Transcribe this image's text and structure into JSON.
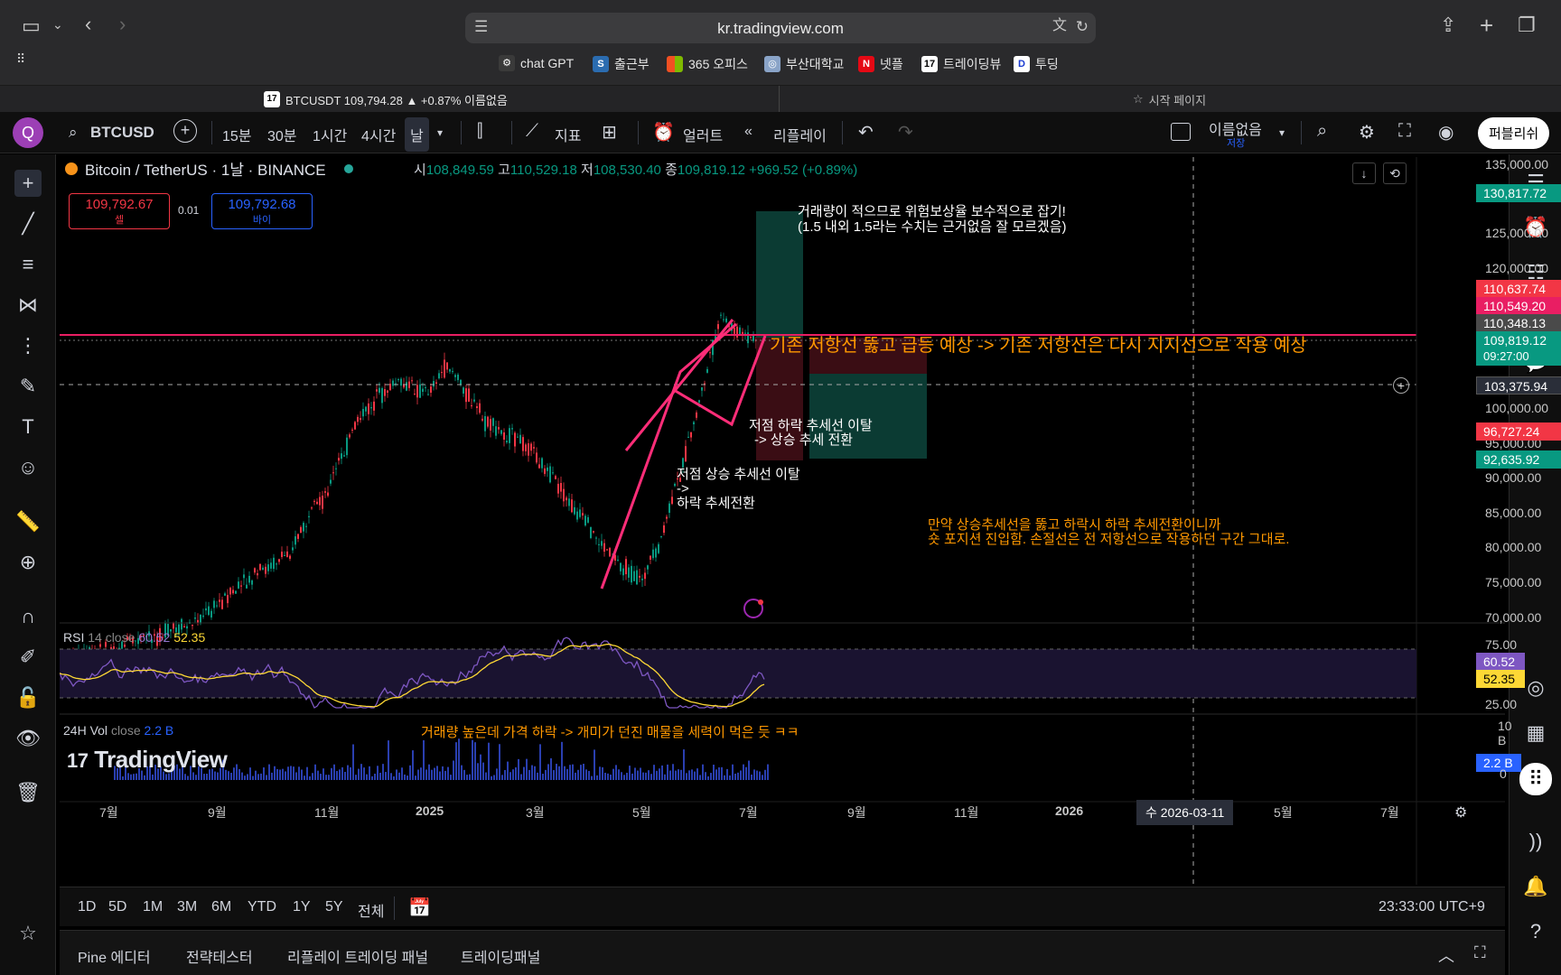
{
  "browser": {
    "url": "kr.tradingview.com",
    "bookmarks": [
      "chat GPT",
      "출근부",
      "365 오피스",
      "부산대학교",
      "넷플",
      "트레이딩뷰",
      "투딩"
    ],
    "tabs": [
      "BTCUSDT 109,794.28 ▲ +0.87% 이름없음",
      "시작 페이지"
    ]
  },
  "toolbar": {
    "avatar": "Q",
    "symbol": "BTCUSD",
    "intervals": [
      "15분",
      "30분",
      "1시간",
      "4시간",
      "날"
    ],
    "indicators": "지표",
    "alert": "얼러트",
    "replay": "리플레이",
    "layout_name": "이름없음",
    "layout_saved": "저장",
    "publish": "퍼블리쉬"
  },
  "legend": {
    "title": "Bitcoin / TetherUS · 1날 · BINANCE",
    "o_label": "시",
    "o": "108,849.59",
    "h_label": "고",
    "h": "110,529.18",
    "l_label": "저",
    "l": "108,530.40",
    "c_label": "종",
    "c": "109,819.12",
    "chg": "+969.52 (+0.89%)",
    "sell_price": "109,792.67",
    "sell_label": "셀",
    "spread": "0.01",
    "buy_price": "109,792.68",
    "buy_label": "바이"
  },
  "annotations": {
    "note1_line1": "거래량이 적으므로 위험보상율 보수적으로 잡기!",
    "note1_line2": "(1.5 내외 1.5라는 수치는 근거없음 잘 모르겠음)",
    "note2": "기존 저항선 뚫고 급등 예상 -> 기존 저항선은 다시 지지선으로 작용 예상",
    "note3_line1": "저점 하락 추세선 이탈",
    "note3_line2": "-> 상승 추세 전환",
    "note4_line1": "저점 상승 추세선 이탈",
    "note4_line2": "->",
    "note4_line3": "하락 추세전환",
    "note5_line1": "만약 상승추세선을 뚫고 하락시 하락 추세전환이니까",
    "note5_line2": "숏 포지션 진입함. 손절선은 전 저항선으로 작용하던 구간 그대로.",
    "note6": "거래량 높은데 가격 하락 -> 개미가 던진 매물을 세력이 먹은 듯 ㅋㅋ"
  },
  "price_axis": [
    "135,000.00",
    "125,000.00",
    "120,000.00",
    "100,000.00",
    "95,000.00",
    "90,000.00",
    "85,000.00",
    "80,000.00",
    "75,000.00",
    "70,000.00"
  ],
  "price_labels": [
    {
      "text": "130,817.72",
      "color": "#089981"
    },
    {
      "text": "110,637.74",
      "color": "#f23645"
    },
    {
      "text": "110,549.20",
      "color": "#e91e63"
    },
    {
      "text": "110,348.13",
      "color": "#4a4a4a"
    },
    {
      "text": "109,819.12",
      "color": "#089981"
    },
    {
      "text": "09:27:00",
      "color": "#089981"
    },
    {
      "text": "103,375.94",
      "color": "#2a2e39"
    },
    {
      "text": "96,727.24",
      "color": "#f23645"
    },
    {
      "text": "92,635.92",
      "color": "#089981"
    }
  ],
  "rsi": {
    "label": "RSI",
    "params": "14 close",
    "v1": "60.52",
    "v2": "52.35",
    "levels": [
      "75.00",
      "25.00"
    ]
  },
  "volume": {
    "label": "24H Vol",
    "params": "close",
    "value": "2.2 B",
    "axis": "10 B",
    "axis_zero": "0"
  },
  "watermark": "TradingView",
  "time_axis": [
    "7월",
    "9월",
    "11월",
    "2025",
    "3월",
    "5월",
    "7월",
    "9월",
    "11월",
    "2026",
    "5월",
    "7월"
  ],
  "crosshair_date": "수 2026-03-11",
  "ranges": [
    "1D",
    "5D",
    "1M",
    "3M",
    "6M",
    "YTD",
    "1Y",
    "5Y",
    "전체"
  ],
  "clock": "23:33:00 UTC+9",
  "panels": [
    "Pine 에디터",
    "전략테스터",
    "리플레이 트레이딩 패널",
    "트레이딩패널"
  ],
  "colors": {
    "up": "#089981",
    "down": "#f23645",
    "trend": "#ff2d78",
    "rsi": "#7e57c2",
    "rsi_ma": "#fdd835",
    "note_orange": "#ff9800"
  }
}
